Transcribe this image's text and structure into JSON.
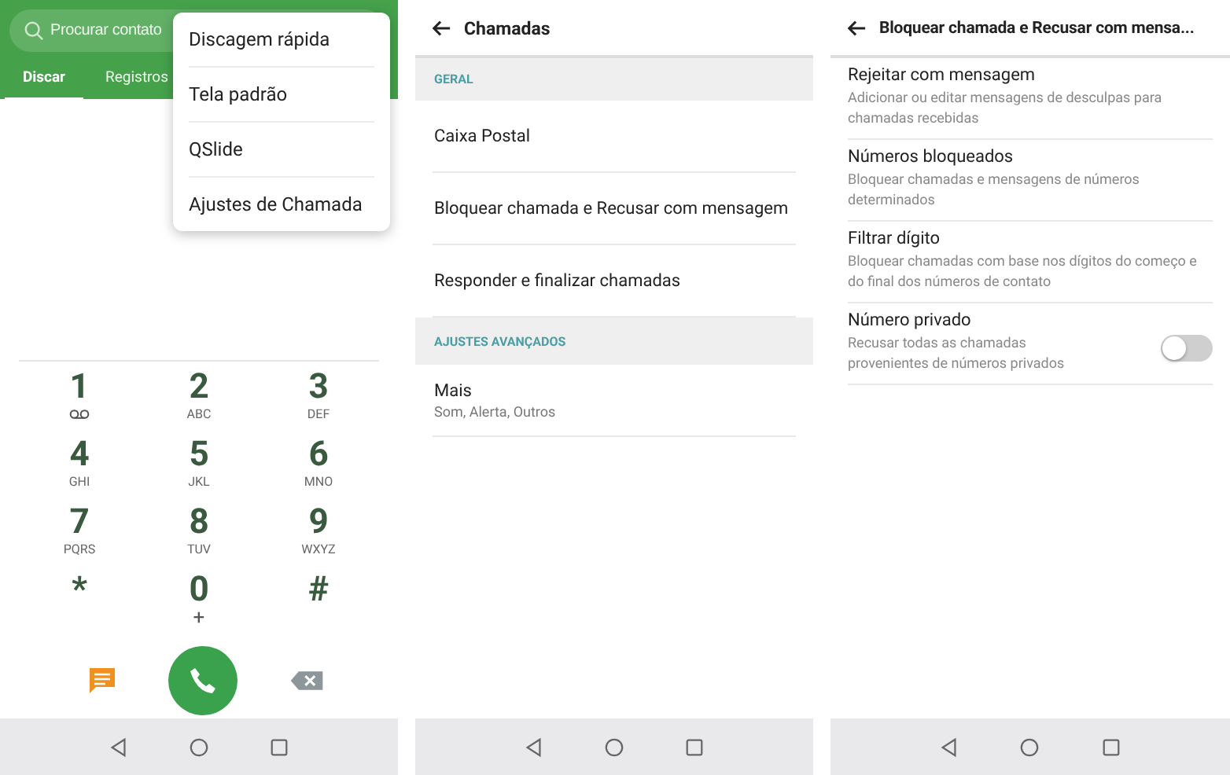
{
  "dialer": {
    "search": {
      "placeholder": "Procurar contato"
    },
    "tabs": [
      {
        "label": "Discar",
        "selected": true
      },
      {
        "label": "Registros",
        "selected": false
      }
    ],
    "menu": [
      "Discagem rápida",
      "Tela padrão",
      "QSlide",
      "Ajustes de Chamada"
    ],
    "keys": [
      {
        "digit": "1",
        "kind": "voicemail"
      },
      {
        "digit": "2",
        "sub": "ABC",
        "kind": "text"
      },
      {
        "digit": "3",
        "sub": "DEF",
        "kind": "text"
      },
      {
        "digit": "4",
        "sub": "GHI",
        "kind": "text"
      },
      {
        "digit": "5",
        "sub": "JKL",
        "kind": "text"
      },
      {
        "digit": "6",
        "sub": "MNO",
        "kind": "text"
      },
      {
        "digit": "7",
        "sub": "PQRS",
        "kind": "text"
      },
      {
        "digit": "8",
        "sub": "TUV",
        "kind": "text"
      },
      {
        "digit": "9",
        "sub": "WXYZ",
        "kind": "text"
      },
      {
        "digit": "*",
        "kind": "text"
      },
      {
        "digit": "0",
        "sub": "+",
        "kind": "text"
      },
      {
        "digit": "#",
        "kind": "text"
      }
    ]
  },
  "calls": {
    "title": "Chamadas",
    "sections": [
      {
        "heading": "GERAL",
        "items": [
          {
            "title": "Caixa Postal"
          },
          {
            "title": "Bloquear chamada e Recusar com mensagem"
          },
          {
            "title": "Responder e finalizar chamadas"
          }
        ]
      },
      {
        "heading": "AJUSTES AVANÇADOS",
        "items": [
          {
            "title": "Mais",
            "subtitle": "Som, Alerta, Outros"
          }
        ]
      }
    ]
  },
  "blocking": {
    "title": "Bloquear chamada e Recusar com mensa...",
    "items": [
      {
        "title": "Rejeitar com mensagem",
        "subtitle": "Adicionar ou editar mensagens de desculpas para chamadas recebidas",
        "kind": "link"
      },
      {
        "title": "Números bloqueados",
        "subtitle": "Bloquear chamadas e mensagens de números determinados",
        "kind": "link"
      },
      {
        "title": "Filtrar dígito",
        "subtitle": "Bloquear chamadas com base nos dígitos do começo e do final dos números de contato",
        "kind": "link"
      },
      {
        "title": "Número privado",
        "subtitle": "Recusar todas as chamadas provenientes de números privados",
        "kind": "toggle",
        "on": false
      }
    ]
  }
}
